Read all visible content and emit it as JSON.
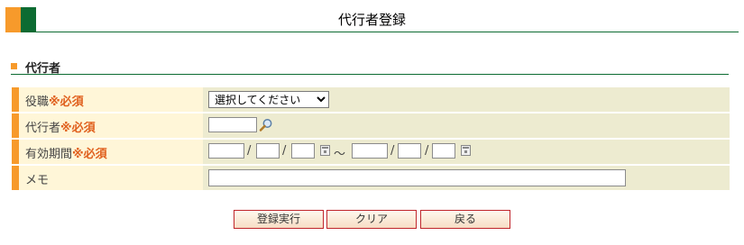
{
  "header": {
    "title": "代行者登録"
  },
  "section": {
    "title": "代行者"
  },
  "form": {
    "required_mark": "※必須",
    "rows": [
      {
        "label": "役職"
      },
      {
        "label": "代行者"
      },
      {
        "label": "有効期間"
      },
      {
        "label": "メモ"
      }
    ],
    "role_select": {
      "selected": "選択してください"
    },
    "date_separator": "/",
    "range_separator": "～"
  },
  "buttons": {
    "register": "登録実行",
    "clear": "クリア",
    "back": "戻る"
  },
  "colors": {
    "accent_orange": "#f79a2b",
    "accent_green": "#0d6b32",
    "required": "#e0601e",
    "button_border": "#c0262c"
  }
}
